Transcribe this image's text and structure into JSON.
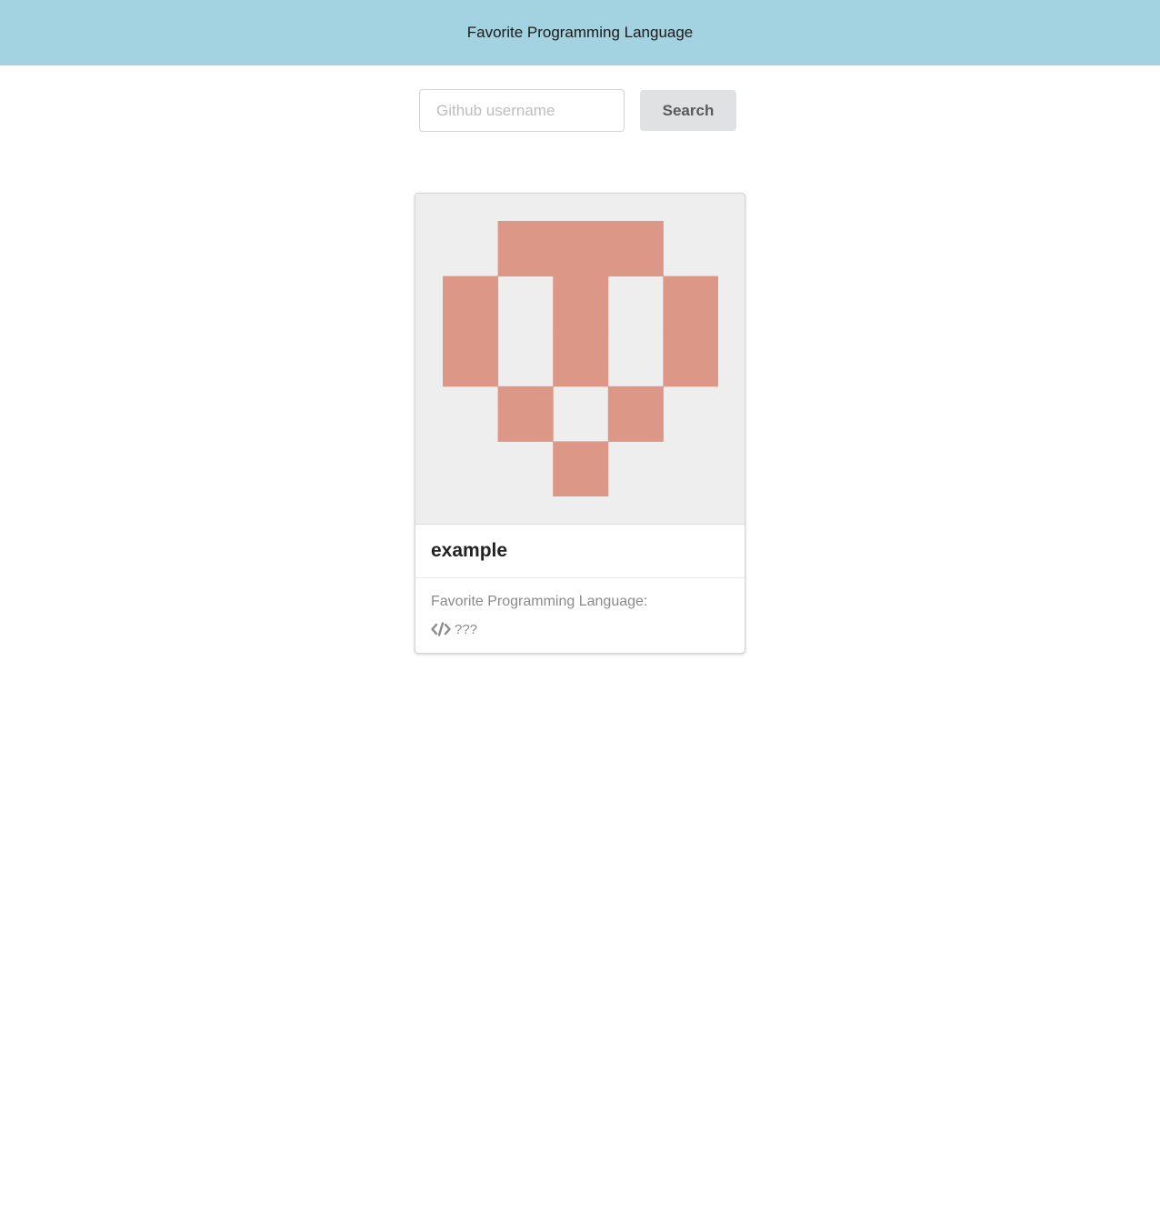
{
  "header": {
    "title": "Favorite Programming Language"
  },
  "search": {
    "placeholder": "Github username",
    "value": "",
    "button_label": "Search"
  },
  "card": {
    "identicon_color": "#dd9787",
    "identicon_background": "#eeeeee",
    "identicon_grid": [
      [
        0,
        1,
        1,
        1,
        0
      ],
      [
        1,
        0,
        1,
        0,
        1
      ],
      [
        1,
        0,
        1,
        0,
        1
      ],
      [
        0,
        1,
        0,
        1,
        0
      ],
      [
        0,
        0,
        1,
        0,
        0
      ]
    ],
    "username": "example",
    "meta_label": "Favorite Programming Language:",
    "language_icon": "code-icon",
    "language": "???"
  },
  "colors": {
    "header_background": "#a3d2e1",
    "button_background": "#e0e1e2"
  }
}
